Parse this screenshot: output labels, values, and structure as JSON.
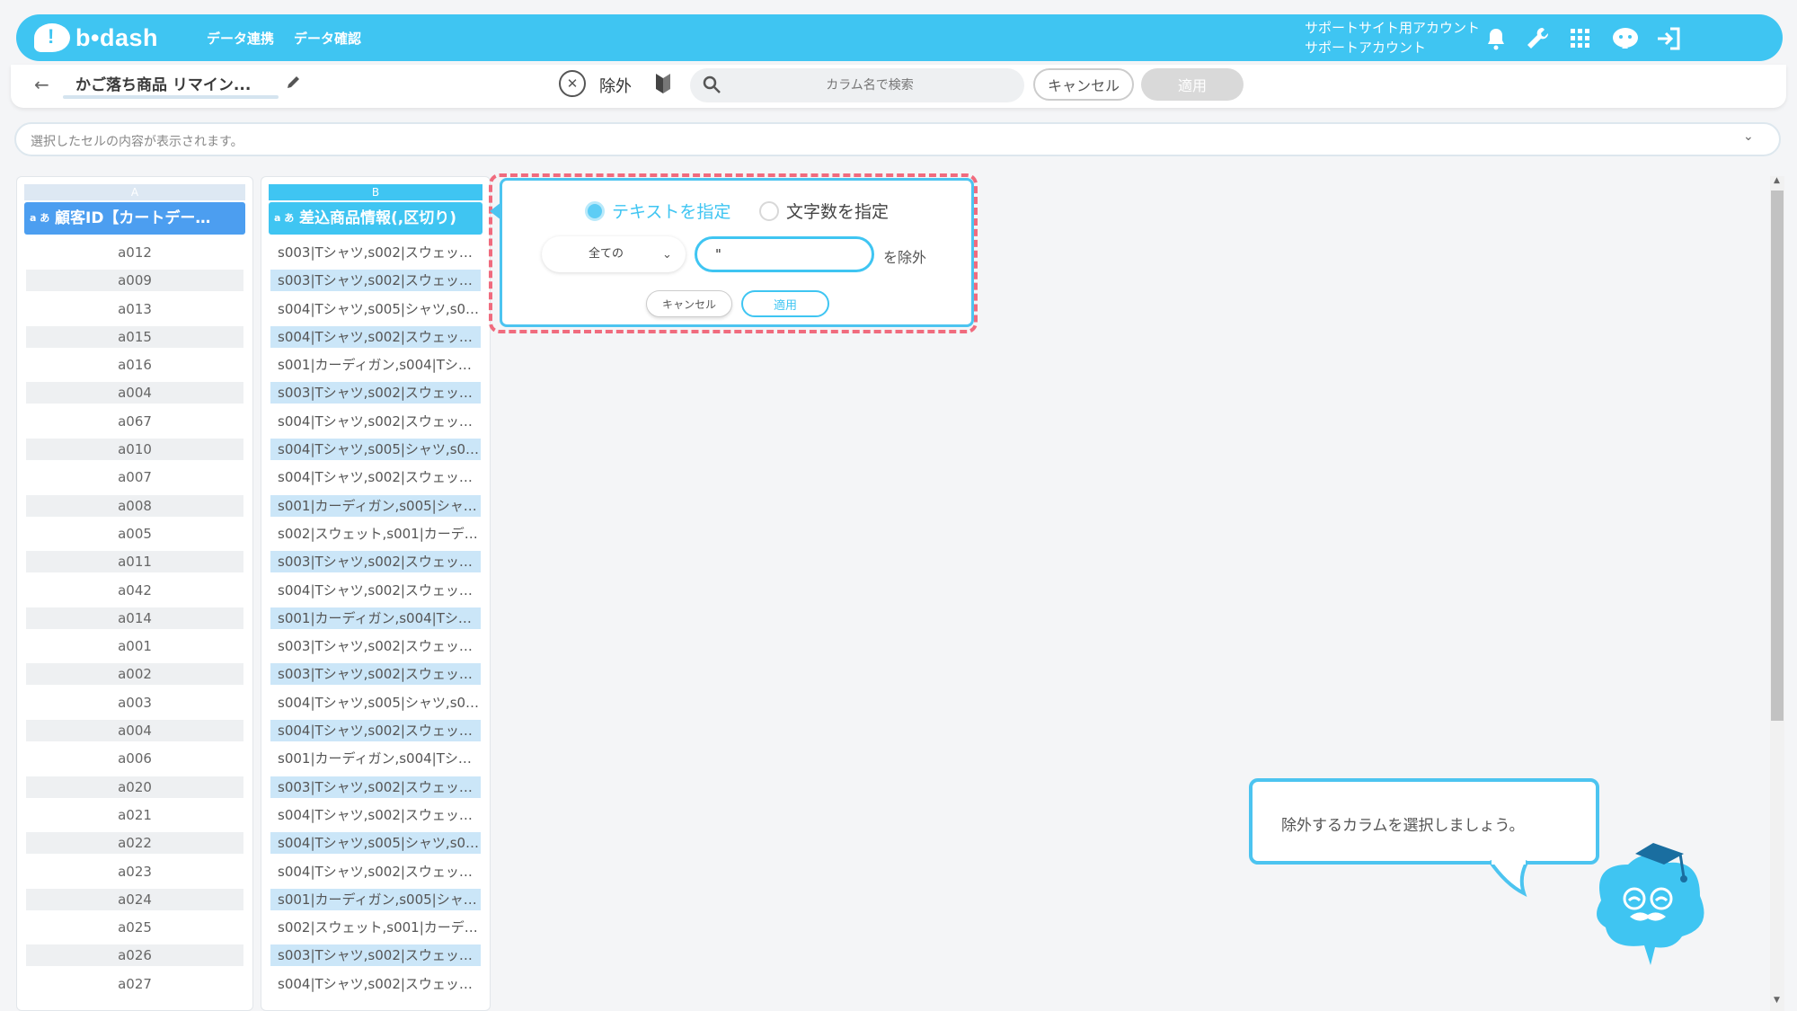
{
  "header": {
    "logo": "b•dash",
    "nav": [
      "データ連携",
      "データ確認"
    ],
    "account_line1": "サポートサイト用アカウント",
    "account_line2": "サポートアカウント"
  },
  "toolbar": {
    "flow_name": "かご落ち商品 リマイン...",
    "operation_label": "除外",
    "search_placeholder": "カラム名で検索",
    "cancel_label": "キャンセル",
    "apply_label": "適用"
  },
  "cell_content": {
    "placeholder": "選択したセルの内容が表示されます。"
  },
  "columns": [
    {
      "letter": "A",
      "type": "a あ",
      "name": "顧客ID【カートデー…",
      "values": [
        "a012",
        "a009",
        "a013",
        "a015",
        "a016",
        "a004",
        "a067",
        "a010",
        "a007",
        "a008",
        "a005",
        "a011",
        "a042",
        "a014",
        "a001",
        "a002",
        "a003",
        "a004",
        "a006",
        "a020",
        "a021",
        "a022",
        "a023",
        "a024",
        "a025",
        "a026",
        "a027"
      ]
    },
    {
      "letter": "B",
      "type": "a あ",
      "name": "差込商品情報(,区切り)",
      "values": [
        "s003|Tシャツ,s002|スウェッ…",
        "s003|Tシャツ,s002|スウェッ…",
        "s004|Tシャツ,s005|シャツ,s0…",
        "s004|Tシャツ,s002|スウェッ…",
        "s001|カーディガン,s004|Tシ…",
        "s003|Tシャツ,s002|スウェッ…",
        "s004|Tシャツ,s002|スウェッ…",
        "s004|Tシャツ,s005|シャツ,s0…",
        "s004|Tシャツ,s002|スウェッ…",
        "s001|カーディガン,s005|シャ…",
        "s002|スウェット,s001|カーデ…",
        "s003|Tシャツ,s002|スウェッ…",
        "s004|Tシャツ,s002|スウェッ…",
        "s001|カーディガン,s004|Tシ…",
        "s003|Tシャツ,s002|スウェッ…",
        "s003|Tシャツ,s002|スウェッ…",
        "s004|Tシャツ,s005|シャツ,s0…",
        "s004|Tシャツ,s002|スウェッ…",
        "s001|カーディガン,s004|Tシ…",
        "s003|Tシャツ,s002|スウェッ…",
        "s004|Tシャツ,s002|スウェッ…",
        "s004|Tシャツ,s005|シャツ,s0…",
        "s004|Tシャツ,s002|スウェッ…",
        "s001|カーディガン,s005|シャ…",
        "s002|スウェット,s001|カーデ…",
        "s003|Tシャツ,s002|スウェッ…",
        "s004|Tシャツ,s002|スウェッ…"
      ]
    }
  ],
  "popup": {
    "radio_text": "テキストを指定",
    "radio_length": "文字数を指定",
    "match_select": "全ての",
    "input_value": "\"",
    "exclude_label": "を除外",
    "cancel_label": "キャンセル",
    "apply_label": "適用"
  },
  "guide": {
    "message": "除外するカラムを選択しましょう。"
  },
  "colors": {
    "brand": "#3fc5f2",
    "highlight_outline": "#f06b7e",
    "header_a": "#4c9ef0"
  }
}
